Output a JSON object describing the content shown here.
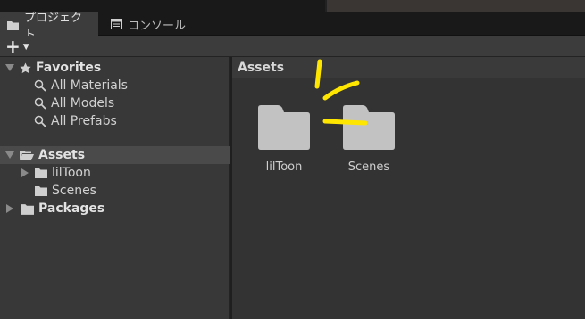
{
  "tabs": [
    {
      "label": "プロジェクト",
      "icon": "folder-icon"
    },
    {
      "label": "コンソール",
      "icon": "console-icon"
    }
  ],
  "toolbar": {
    "add_label": "+",
    "add_icon": "plus-icon",
    "dropdown_icon": "caret-down-icon"
  },
  "tree": {
    "favorites": {
      "label": "Favorites",
      "icon": "star-icon",
      "items": [
        {
          "label": "All Materials",
          "icon": "search-icon"
        },
        {
          "label": "All Models",
          "icon": "search-icon"
        },
        {
          "label": "All Prefabs",
          "icon": "search-icon"
        }
      ]
    },
    "assets": {
      "label": "Assets",
      "icon": "folder-open-icon",
      "items": [
        {
          "label": "lilToon",
          "icon": "folder-icon",
          "expandable": true
        },
        {
          "label": "Scenes",
          "icon": "folder-icon",
          "expandable": false
        }
      ]
    },
    "packages": {
      "label": "Packages",
      "icon": "folder-icon"
    }
  },
  "content": {
    "header": "Assets",
    "folders": [
      {
        "label": "lilToon",
        "icon": "folder-icon"
      },
      {
        "label": "Scenes",
        "icon": "folder-icon"
      }
    ]
  },
  "colors": {
    "annotation": "#ffe600",
    "folder": "#c2c2c2",
    "selected_row": "#4a4a4a"
  }
}
